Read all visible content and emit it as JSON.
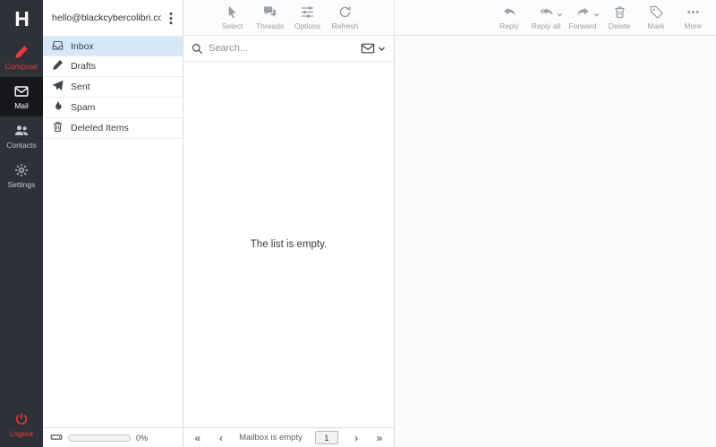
{
  "colors": {
    "sidebar-bg": "#2e3138",
    "sidebar-active-bg": "#17181c",
    "accent-red": "#f23a3a",
    "selected-blue": "#d5e8f7",
    "border": "#dddddd",
    "toolbar-gray": "#9a9ea6"
  },
  "app": {
    "logo_letter": "H"
  },
  "taskbar": {
    "compose": "Compose",
    "mail": "Mail",
    "contacts": "Contacts",
    "settings": "Settings",
    "logout": "Logout"
  },
  "folders": {
    "account": "hello@blackcybercolibri.com",
    "items": [
      {
        "label": "Inbox"
      },
      {
        "label": "Drafts"
      },
      {
        "label": "Sent"
      },
      {
        "label": "Spam"
      },
      {
        "label": "Deleted Items"
      }
    ],
    "quota_percent": "0%"
  },
  "toolbar": {
    "left": [
      {
        "label": "Select"
      },
      {
        "label": "Threads"
      },
      {
        "label": "Options"
      },
      {
        "label": "Refresh"
      }
    ],
    "right": [
      {
        "label": "Reply"
      },
      {
        "label": "Reply all"
      },
      {
        "label": "Forward"
      },
      {
        "label": "Delete"
      },
      {
        "label": "Mark"
      },
      {
        "label": "More"
      }
    ]
  },
  "message_list": {
    "search_placeholder": "Search...",
    "empty_text": "The list is empty.",
    "pagination": {
      "first": "«",
      "prev": "‹",
      "next": "›",
      "last": "»",
      "status": "Mailbox is empty",
      "page": "1"
    }
  }
}
